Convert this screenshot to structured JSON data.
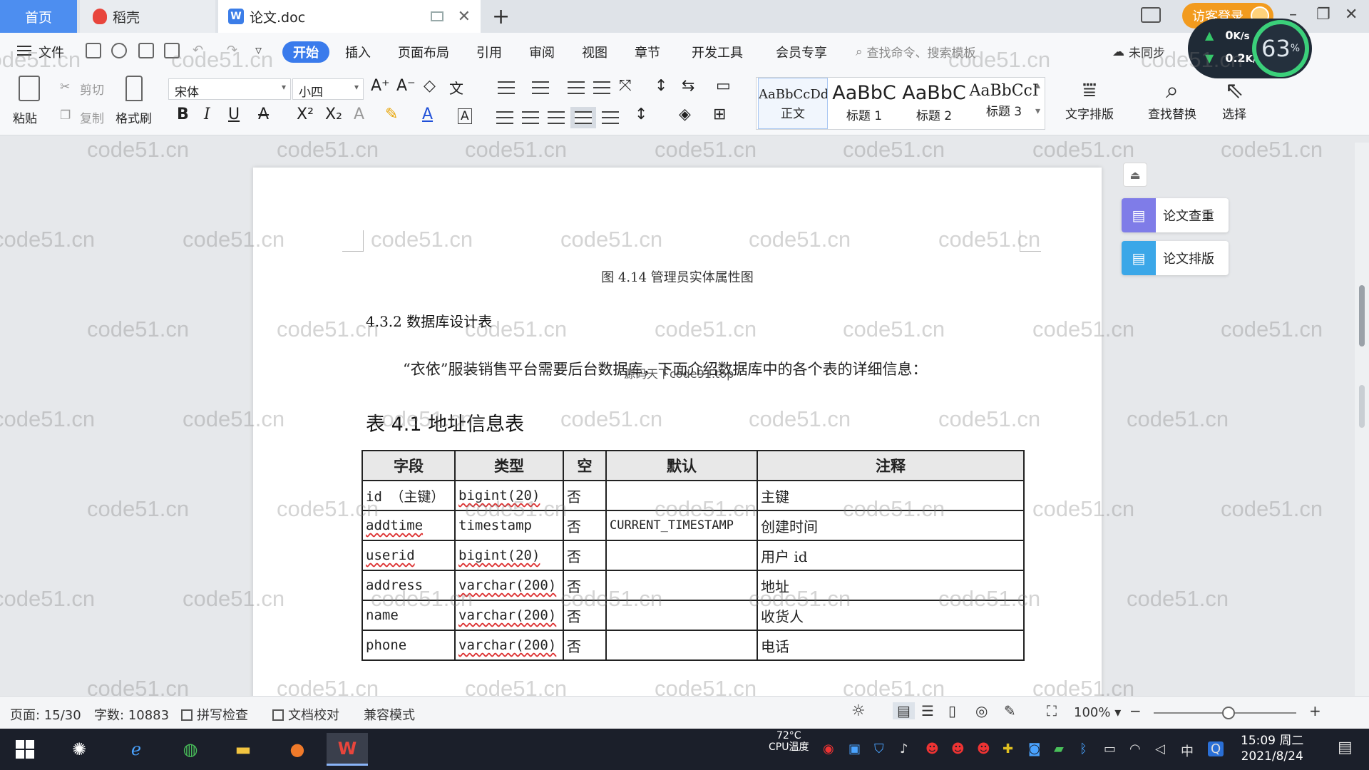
{
  "tabs": {
    "home": "首页",
    "daoke": "稻壳",
    "doc": "论文.doc"
  },
  "header": {
    "visitor_login": "访客登录",
    "new_tab": "+"
  },
  "menu": {
    "file": "文件",
    "start": "开始",
    "items": [
      "插入",
      "页面布局",
      "引用",
      "审阅",
      "视图",
      "章节",
      "开发工具",
      "会员专享"
    ],
    "search_placeholder": "查找命令、搜索模板",
    "sync": "未同步"
  },
  "netspeed": {
    "up": "0",
    "up_unit": "K/s",
    "down": "0.2",
    "down_unit": "K/s",
    "cpu": "63",
    "cpu_unit": "%"
  },
  "ribbon": {
    "paste": "粘贴",
    "cut": "剪切",
    "copy": "复制",
    "format_painter": "格式刷",
    "font_name": "宋体",
    "font_size": "小四",
    "styles": [
      {
        "sample": "AaBbCcDd",
        "name": "正文"
      },
      {
        "sample": "AaBbC",
        "name": "标题 1"
      },
      {
        "sample": "AaBbC",
        "name": "标题 2"
      },
      {
        "sample": "AaBbCcI",
        "name": "标题 3"
      }
    ],
    "text_layout": "文字排版",
    "find_replace": "查找替换",
    "select": "选择"
  },
  "document": {
    "figure_caption": "图 4.14  管理员实体属性图",
    "section_heading": "4.3.2 数据库设计表",
    "paragraph": "“衣依”服装销售平台需要后台数据库，下面介绍数据库中的各个表的详细信息：",
    "overlay_text": "源码天下code91.top",
    "table_title": "表 4.1  地址信息表",
    "table": {
      "headers": [
        "字段",
        "类型",
        "空",
        "默认",
        "注释"
      ],
      "rows": [
        [
          "id  （主键）",
          "bigint(20)",
          "否",
          "",
          "主键"
        ],
        [
          "addtime",
          "timestamp",
          "否",
          "CURRENT_TIMESTAMP",
          "创建时间"
        ],
        [
          "userid",
          "bigint(20)",
          "否",
          "",
          "用户 id"
        ],
        [
          "address",
          "varchar(200)",
          "否",
          "",
          "地址"
        ],
        [
          "name",
          "varchar(200)",
          "否",
          "",
          "收货人"
        ],
        [
          "phone",
          "varchar(200)",
          "否",
          "",
          "电话"
        ]
      ]
    }
  },
  "watermark": "code51.cn",
  "side_panel": {
    "paper_check": "论文查重",
    "paper_format": "论文排版"
  },
  "status": {
    "page": "页面: 15/30",
    "words": "字数: 10883",
    "spell_check": "拼写检查",
    "doc_proof": "文档校对",
    "compat": "兼容模式",
    "zoom": "100%"
  },
  "taskbar": {
    "temp": "72°C",
    "temp_label": "CPU温度",
    "ime": "中",
    "time": "15:09 周二",
    "date": "2021/8/24"
  }
}
